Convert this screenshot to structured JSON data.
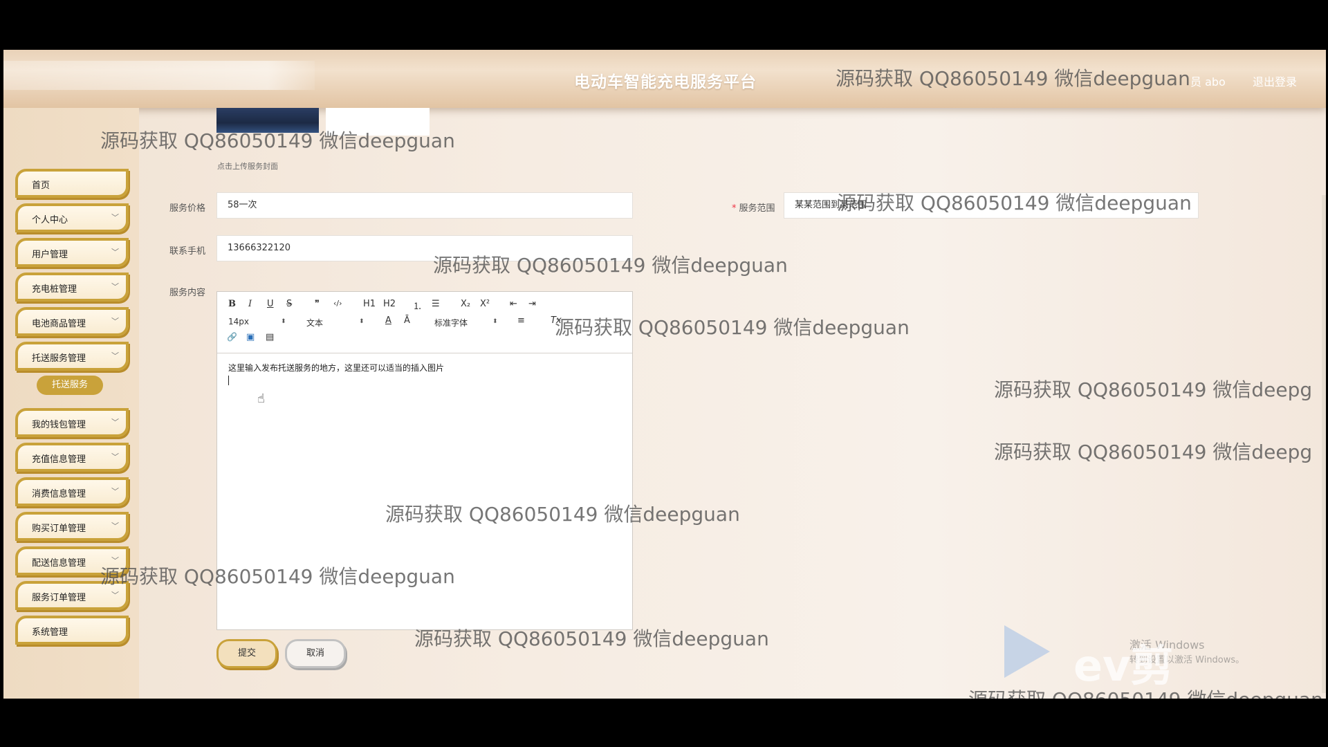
{
  "header": {
    "title": "电动车智能充电服务平台",
    "user": "员 abo",
    "logout": "退出登录"
  },
  "sidebar": {
    "items": [
      {
        "label": "首页",
        "chevron": ""
      },
      {
        "label": "个人中心",
        "chevron": "﹀"
      },
      {
        "label": "用户管理",
        "chevron": "﹀"
      },
      {
        "label": "充电桩管理",
        "chevron": "﹀"
      },
      {
        "label": "电池商品管理",
        "chevron": "﹀"
      },
      {
        "label": "托送服务管理",
        "chevron": "﹀"
      },
      {
        "label": "我的钱包管理",
        "chevron": "﹀"
      },
      {
        "label": "充值信息管理",
        "chevron": "﹀"
      },
      {
        "label": "消费信息管理",
        "chevron": "﹀"
      },
      {
        "label": "购买订单管理",
        "chevron": "﹀"
      },
      {
        "label": "配送信息管理",
        "chevron": "﹀"
      },
      {
        "label": "服务订单管理",
        "chevron": "﹀"
      },
      {
        "label": "系统管理",
        "chevron": ""
      }
    ],
    "active_sub": "托送服务"
  },
  "form": {
    "cover_hint": "点击上传服务封面",
    "price_label": "服务价格",
    "price_value": "58一次",
    "scope_label": "服务范围",
    "scope_value": "某某范围到某范围",
    "phone_label": "联系手机",
    "phone_value": "13666322120",
    "content_label": "服务内容",
    "editor_text": "这里输入发布托送服务的地方，这里还可以适当的插入图片",
    "submit": "提交",
    "cancel": "取消"
  },
  "toolbar": {
    "bold": "B",
    "italic": "I",
    "underline": "U",
    "strike": "S",
    "quote": "❞",
    "code": "‹/›",
    "h1": "H1",
    "h2": "H2",
    "ol": "⒈",
    "ul": "☰",
    "sub": "X₂",
    "sup": "X²",
    "outdent": "⇤",
    "indent": "⇥",
    "size": "14px",
    "header": "文本",
    "font": "标准字体",
    "color": "A",
    "bg": "Ā",
    "align": "≡",
    "clean": "Tx",
    "link": "🔗",
    "image": "▣",
    "video": "▤",
    "arrow": "⬍"
  },
  "watermarks": [
    "源码获取 QQ86050149 微信deepguan",
    "源码获取 QQ86050149 微信deepg",
    "源码获取 QQ86050149 微信deepguan"
  ],
  "overlay": {
    "logo_text": "ev剪辑",
    "activation_line1": "激活 Windows",
    "activation_line2": "转到设置以激活 Windows。"
  }
}
